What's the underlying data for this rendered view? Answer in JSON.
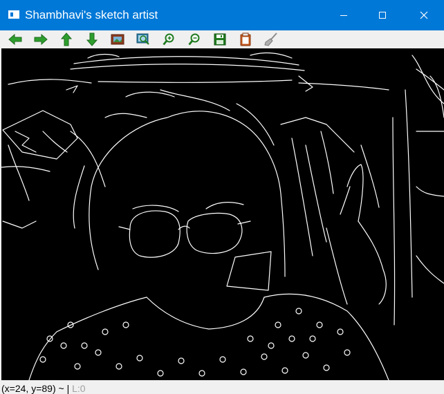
{
  "window": {
    "title": "Shambhavi's sketch artist",
    "title_bar_color": "#0078d7"
  },
  "caption_buttons": [
    "minimize-icon",
    "maximize-icon",
    "close-icon"
  ],
  "toolbar": {
    "buttons": [
      {
        "name": "pan-left",
        "icon": "arrow-left-icon",
        "color": "#2e9e2e"
      },
      {
        "name": "pan-right",
        "icon": "arrow-right-icon",
        "color": "#2e9e2e"
      },
      {
        "name": "pan-up",
        "icon": "arrow-up-icon",
        "color": "#2e9e2e"
      },
      {
        "name": "pan-down",
        "icon": "arrow-down-icon",
        "color": "#2e9e2e"
      },
      {
        "name": "zoom-fit",
        "icon": "picture-icon",
        "color": "#8b3a1e"
      },
      {
        "name": "zoom-actual",
        "icon": "picture-zoom-icon",
        "color": "#2c7da0"
      },
      {
        "name": "zoom-in",
        "icon": "zoom-in-icon",
        "color": "#1f7a1f"
      },
      {
        "name": "zoom-out",
        "icon": "zoom-out-icon",
        "color": "#1f7a1f"
      },
      {
        "name": "save",
        "icon": "floppy-disk-icon",
        "color": "#1f7a1f"
      },
      {
        "name": "copy",
        "icon": "clipboard-icon",
        "color": "#c0561b"
      },
      {
        "name": "properties",
        "icon": "broom-icon",
        "color": "#8a8a8a"
      }
    ]
  },
  "canvas": {
    "description_image": "edge-detected sketch",
    "background": "#000000",
    "stroke": "#ffffff"
  },
  "status": {
    "coords": "(x=24, y=89) ~",
    "value": "L:0"
  }
}
